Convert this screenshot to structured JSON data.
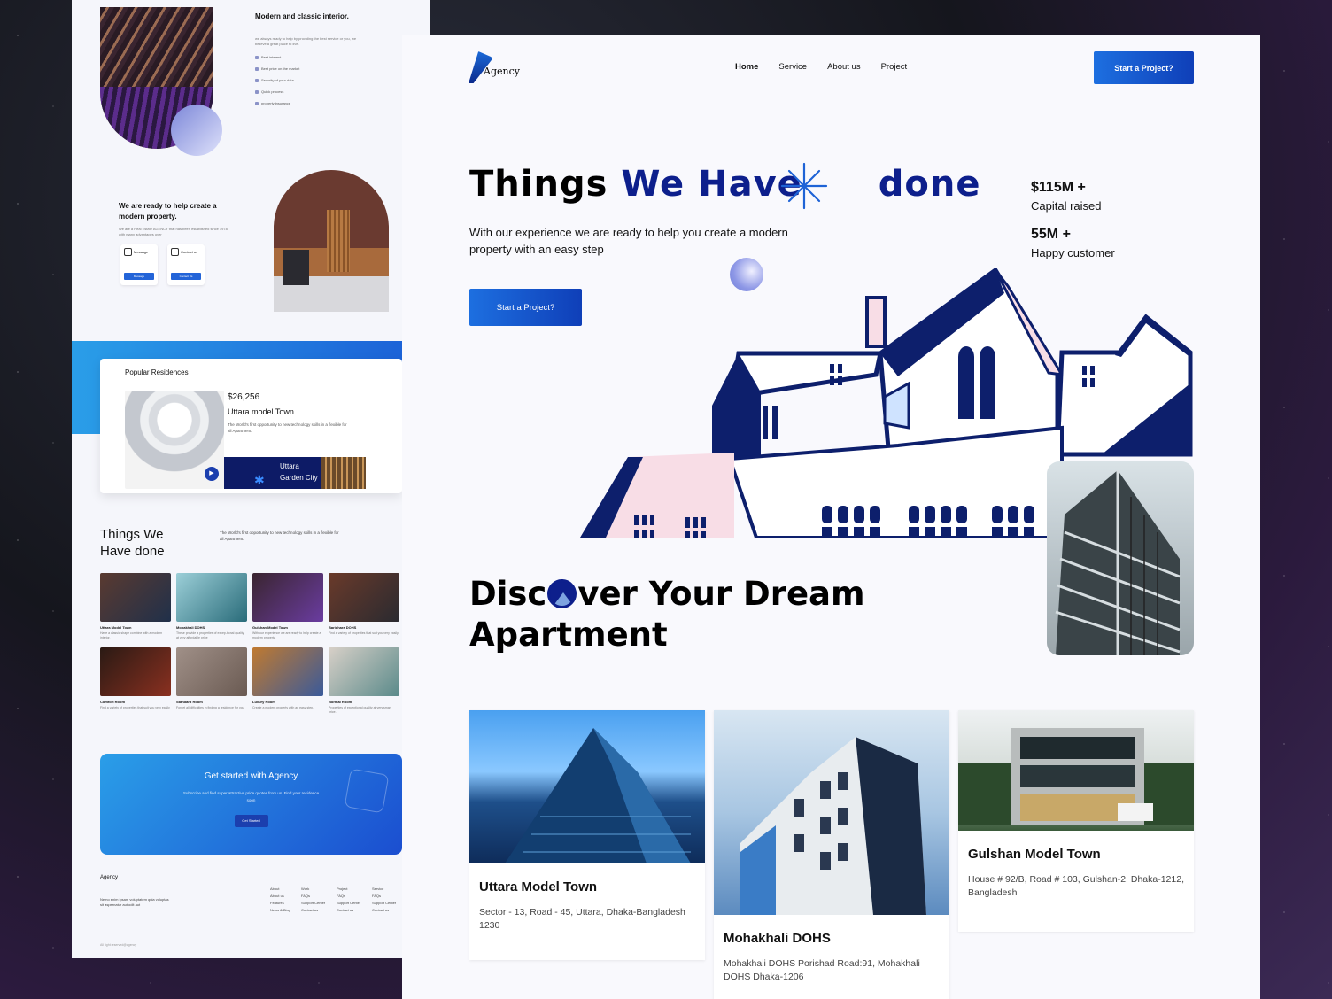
{
  "colors": {
    "accent": "#1d6fe0",
    "brand_dark": "#0d1f8c"
  },
  "left_preview": {
    "hero_title": "Modern and classic interior.",
    "hero_sub": "we always ready to help by providing the best service or you, we believe a great place to live.",
    "features": [
      "Best interest",
      "Best price on the market",
      "Security of your data",
      "Quick process",
      "property insurance"
    ],
    "ready_title": "We are ready to help create a modern property.",
    "ready_sub": "We are a Real Estate AGENCY that has been established since 1978 with many advantages over",
    "cards": [
      {
        "title": "Message",
        "button": "Message"
      },
      {
        "title": "Contact us",
        "button": "Contact Us"
      }
    ],
    "popular_title": "Popular Residences",
    "popular_price": "$26,256",
    "popular_name": "Uttara model Town",
    "popular_desc": "The World's first opportunity to new technology skills in a flexible for all Apartment.",
    "garden_label": "Uttara Garden City",
    "things_title": "Things We Have done",
    "things_sub": "The World's first opportunity to new technology skills in a flexible for all Apartment.",
    "grid": [
      {
        "name": "Uttara Model Town",
        "desc": "Have a classic shape combine with a modern interior."
      },
      {
        "name": "Mohakhali DOHS",
        "desc": "These provide a properties of excep-tional quality at very affordable price"
      },
      {
        "name": "Gulshan Model Town",
        "desc": "With our experience we are ready to help create a modern property."
      },
      {
        "name": "Baridhara DOHS",
        "desc": "Find a variety of properties that suit you very easily."
      },
      {
        "name": "Comfort Room",
        "desc": "Find a variety of properties that suit you very easily"
      },
      {
        "name": "Standard Room",
        "desc": "Forget all difficulties in finding a residence for you"
      },
      {
        "name": "Luxury Room",
        "desc": "Create a modern property with an easy step."
      },
      {
        "name": "Normal Room",
        "desc": "Properties of exceptional quality at very smart price."
      }
    ],
    "cta_title": "Get started with Agency",
    "cta_sub": "Subscribe and find super attractive price quotes from us. Find your residence soon",
    "cta_button": "Get Started",
    "footer_logo": "Agency",
    "footer_text": "Nemo enim ipsam voluptatem quia voluptas sit aspernatur aut odit aut",
    "footer_cols": [
      {
        "head": "About",
        "items": [
          "About us",
          "Features",
          "News & Blog"
        ]
      },
      {
        "head": "Work",
        "items": [
          "FAQs",
          "Support Center",
          "Contact us"
        ]
      },
      {
        "head": "Project",
        "items": [
          "FAQs",
          "Support Center",
          "Contact us"
        ]
      },
      {
        "head": "Service",
        "items": [
          "FAQs",
          "Support Center",
          "Contact us"
        ]
      }
    ],
    "copyright": "All right reserved@agency"
  },
  "main": {
    "logo_text": "Agency",
    "nav": [
      "Home",
      "Service",
      "About us",
      "Project"
    ],
    "nav_cta": "Start a Project?",
    "hero_title_parts": [
      "Things ",
      "We",
      " ",
      "Have",
      " ",
      "done"
    ],
    "hero_sub": "With our experience we are ready to help you create a modern property with an easy step",
    "hero_cta": "Start a Project?",
    "stats": [
      {
        "value": "$115M +",
        "label": "Capital raised"
      },
      {
        "value": "55M +",
        "label": "Happy customer"
      }
    ],
    "discover_line1_a": "Disc",
    "discover_line1_b": "ver Your Dream",
    "discover_line2": "Apartment",
    "properties": [
      {
        "name": "Uttara Model Town",
        "address": "Sector - 13, Road - 45,  Uttara, Dhaka-Bangladesh 1230"
      },
      {
        "name": "Mohakhali DOHS",
        "address": "Mohakhali DOHS Porishad Road:91, Mohakhali DOHS Dhaka-1206"
      },
      {
        "name": "Gulshan Model Town",
        "address": "House # 92/B, Road # 103, Gulshan-2, Dhaka-1212, Bangladesh"
      }
    ]
  }
}
